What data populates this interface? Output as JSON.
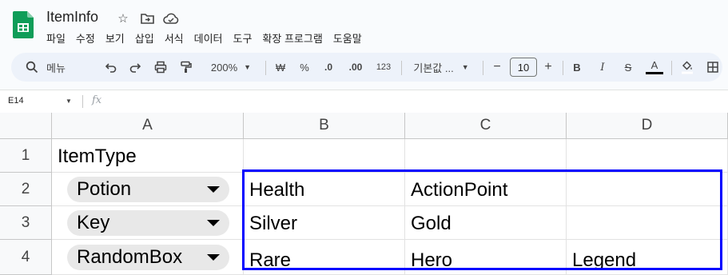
{
  "app": {
    "doc_title": "ItemInfo",
    "icons": [
      "star-icon",
      "move-to-folder-icon",
      "cloud-status-icon"
    ]
  },
  "menu": [
    "파일",
    "수정",
    "보기",
    "삽입",
    "서식",
    "데이터",
    "도구",
    "확장 프로그램",
    "도움말"
  ],
  "toolbar": {
    "search_label": "메뉴",
    "zoom": "200%",
    "currency": "₩",
    "percent": "%",
    "decrease_decimal": ".0",
    "increase_decimal": ".00",
    "number_format": "123",
    "font": "기본값 ...",
    "font_size": "10",
    "minus": "−",
    "plus": "+",
    "bold": "B",
    "italic": "I",
    "strike": "S",
    "text_color": "A"
  },
  "formula_bar": {
    "cell_ref": "E14",
    "fx": "fx"
  },
  "sheet": {
    "columns": [
      "A",
      "B",
      "C",
      "D"
    ],
    "rows": [
      "1",
      "2",
      "3",
      "4"
    ],
    "a1": "ItemType",
    "chips": [
      "Potion",
      "Key",
      "RandomBox"
    ],
    "cells": {
      "b2": "Health",
      "c2": "ActionPoint",
      "d2": "",
      "b3": "Silver",
      "c3": "Gold",
      "d3": "",
      "b4": "Rare",
      "c4": "Hero",
      "d4": "Legend"
    }
  },
  "colors": {
    "selection_border": "#0000ff",
    "chip_bg": "#e8e8e8",
    "sheets_green": "#0f9d58"
  }
}
